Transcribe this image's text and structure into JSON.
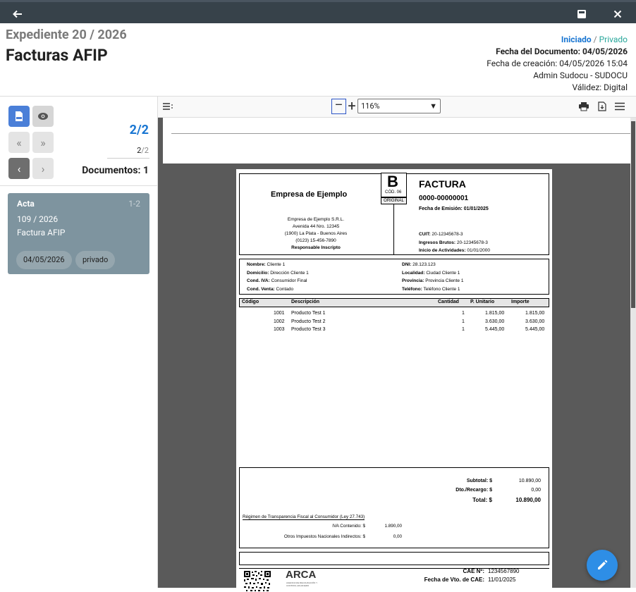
{
  "topbar": {
    "back_icon": "arrow-left-icon",
    "save_icon": "save-icon",
    "close_icon": "close-icon"
  },
  "header": {
    "expediente": "Expediente 20 / 2026",
    "titulo": "Facturas AFIP",
    "estado": "Iniciado",
    "estado_sep": "/",
    "visibilidad": "Privado",
    "fecha_documento_label": "Fecha del Documento:",
    "fecha_documento": "04/05/2026",
    "fecha_creacion_label": "Fecha de creación:",
    "fecha_creacion": "04/05/2026 15:04",
    "autor": "Admin Sudocu - SUDOCU",
    "validez_label": "Válidez:",
    "validez": "Digital"
  },
  "left": {
    "count_big": "2/2",
    "count_small_a": "2",
    "count_small_b": "/2",
    "documentos_label": "Documentos:",
    "documentos_count": "1",
    "card": {
      "tipo": "Acta",
      "rango": "1-2",
      "numero": "109 / 2026",
      "nombre": "Factura AFIP",
      "fecha": "04/05/2026",
      "visibilidad": "privado"
    }
  },
  "viewer": {
    "zoom": "116%",
    "minus": "–",
    "plus": "+"
  },
  "invoice": {
    "empresa": "Empresa de Ejemplo",
    "letra": "B",
    "cod": "CÓD. 06",
    "original": "ORIGINAL",
    "tipo": "FACTURA",
    "numero": "0000-00000001",
    "fecha_emision": "Fecha de Emisión: 01/01/2025",
    "razon_social": "Empresa de Ejemplo S.R.L.",
    "direccion": "Avenida 44 Nro. 12345",
    "ciudad": "(1900) La Plata - Buenos Aires",
    "telefono": "(0123) 15-456-7890",
    "cond_iva": "Responsable Inscripto",
    "cuit_label": "CUIT:",
    "cuit": "20-12345678-3",
    "iibb_label": "Ingresos Brutos:",
    "iibb": "20-12345678-3",
    "inicio_label": "Inicio de Actividades:",
    "inicio": "01/01/2000",
    "cliente": [
      {
        "label": "Nombre:",
        "value": "Cliente 1"
      },
      {
        "label": "Domicilio:",
        "value": "Dirección Cliente 1"
      },
      {
        "label": "Cond. IVA:",
        "value": "Consumidor Final"
      },
      {
        "label": "Cond. Venta:",
        "value": "Contado"
      }
    ],
    "cliente_r": [
      {
        "label": "DNI:",
        "value": "28.123.123"
      },
      {
        "label": "Localidad:",
        "value": "Ciudad Cliente 1"
      },
      {
        "label": "Provincia:",
        "value": "Provincia Cliente 1"
      },
      {
        "label": "Teléfono:",
        "value": "Teléfono Cliente 1"
      }
    ],
    "columnas": [
      "Código",
      "Descripción",
      "Cantidad",
      "P. Unitario",
      "Importe"
    ],
    "items": [
      {
        "codigo": "1001",
        "desc": "Producto Test 1",
        "cant": "1",
        "unit": "1.815,00",
        "imp": "1.815,00"
      },
      {
        "codigo": "1002",
        "desc": "Producto Test 2",
        "cant": "1",
        "unit": "3.630,00",
        "imp": "3.630,00"
      },
      {
        "codigo": "1003",
        "desc": "Producto Test 3",
        "cant": "1",
        "unit": "5.445,00",
        "imp": "5.445,00"
      }
    ],
    "subtotal_label": "Subtotal: $",
    "subtotal": "10.890,00",
    "dto_label": "Dto./Recargo: $",
    "dto": "0,00",
    "total_label": "Total: $",
    "total": "10.890,00",
    "regimen": "Régimen de Transparencia Fiscal al Consumidor (Ley 27.743)",
    "iva_label": "IVA Contenido: $",
    "iva": "1.890,00",
    "otros_label": "Otros Impuestos Nacionales Indirectos: $",
    "otros": "0,00",
    "arca": "ARCA",
    "arca_sub": "AGENCIA DE RECAUDACIÓN Y CONTROL ADUANERO",
    "cae_label": "CAE Nº:",
    "cae": "1234567890",
    "vto_label": "Fecha de Vto. de CAE:",
    "vto": "11/01/2025"
  }
}
